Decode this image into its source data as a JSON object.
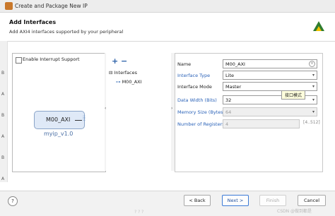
{
  "window": {
    "title": "Create and Package New IP"
  },
  "header": {
    "title": "Add Interfaces",
    "subtitle": "Add AXI4 interfaces supported by your peripheral"
  },
  "left_strip": [
    "B",
    "A",
    "B",
    "A",
    "B",
    "A"
  ],
  "left_panel": {
    "checkbox_label": "Enable Interrupt Support",
    "checkbox_checked": false,
    "ip_port": "M00_AXI",
    "ip_name": "myip_v1.0"
  },
  "middle_panel": {
    "add_label": "+",
    "remove_label": "−",
    "tree": {
      "root": "Interfaces",
      "children": [
        "M00_AXI"
      ]
    }
  },
  "right_panel": {
    "name": {
      "label": "Name",
      "value": "M00_AXI"
    },
    "interface_type": {
      "label": "Interface Type",
      "value": "Lite"
    },
    "interface_mode": {
      "label": "Interface Mode",
      "value": "Master"
    },
    "data_width": {
      "label": "Data Width (Bits)",
      "value": "32"
    },
    "memory_size": {
      "label": "Memory Size (Bytes)",
      "value": "64"
    },
    "num_registers": {
      "label": "Number of Registers",
      "value": "4",
      "range": "[4..512]"
    },
    "tooltip": "接口模式"
  },
  "footer": {
    "help": "?",
    "back": "< Back",
    "next": "Next >",
    "finish": "Finish",
    "cancel": "Cancel"
  },
  "watermark": "CSDN @做到都是",
  "watermark_small": "? ? ?"
}
